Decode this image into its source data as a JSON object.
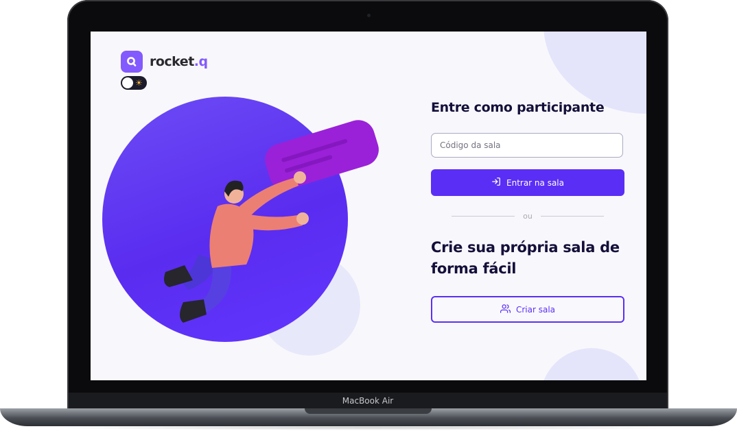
{
  "device": {
    "label": "MacBook Air"
  },
  "app": {
    "name_main": "rocket",
    "name_dot": ".q",
    "icon": "search-logo-icon",
    "theme_toggle_icon": "sun-icon"
  },
  "join": {
    "title": "Entre como participante",
    "room_code_placeholder": "Código da sala",
    "room_code_value": "",
    "enter_button": "Entrar na sala",
    "enter_icon": "log-in-icon"
  },
  "divider": {
    "text": "ou"
  },
  "create": {
    "title": "Crie sua própria sala de forma fácil",
    "button": "Criar sala",
    "button_icon": "users-icon"
  },
  "colors": {
    "accent": "#835afd",
    "primary_button": "#5b2ef6",
    "heading": "#140f3a",
    "background": "#f8f8fc"
  }
}
